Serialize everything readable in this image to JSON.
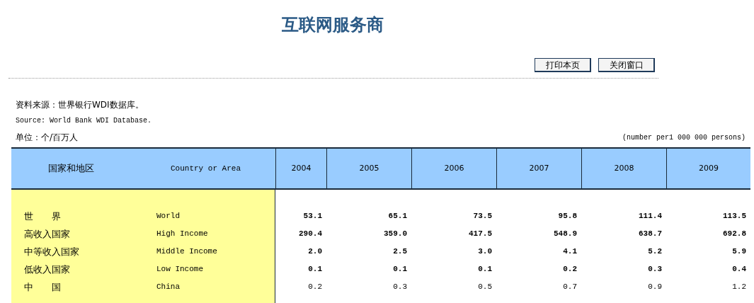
{
  "title": "互联网服务商",
  "buttons": [
    "打印本页",
    "关闭窗口"
  ],
  "source_cn": "资料来源：世界银行WDI数据库。",
  "source_en": "Source: World Bank WDI Database.",
  "unit_cn": "单位：个/百万人",
  "unit_en": "(number per1 000 000 persons)",
  "table": {
    "columns": [
      "国家和地区",
      "Country or Area",
      "2004",
      "2005",
      "2006",
      "2007",
      "2008",
      "2009"
    ],
    "rows": [
      {
        "name_cn": "世　　界",
        "name_en": "World",
        "bold": true,
        "values": [
          "53.1",
          "65.1",
          "73.5",
          "95.8",
          "111.4",
          "113.5"
        ]
      },
      {
        "name_cn": "高收入国家",
        "name_en": "High Income",
        "bold": true,
        "values": [
          "290.4",
          "359.0",
          "417.5",
          "548.9",
          "638.7",
          "692.8"
        ]
      },
      {
        "name_cn": "中等收入国家",
        "name_en": "Middle Income",
        "bold": true,
        "values": [
          "2.0",
          "2.5",
          "3.0",
          "4.1",
          "5.2",
          "5.9"
        ]
      },
      {
        "name_cn": "低收入国家",
        "name_en": "Low Income",
        "bold": true,
        "values": [
          "0.1",
          "0.1",
          "0.1",
          "0.2",
          "0.3",
          "0.4"
        ]
      },
      {
        "name_cn": "中　　国",
        "name_en": "China",
        "bold": false,
        "values": [
          "0.2",
          "0.3",
          "0.5",
          "0.7",
          "0.9",
          "1.2"
        ]
      }
    ]
  }
}
